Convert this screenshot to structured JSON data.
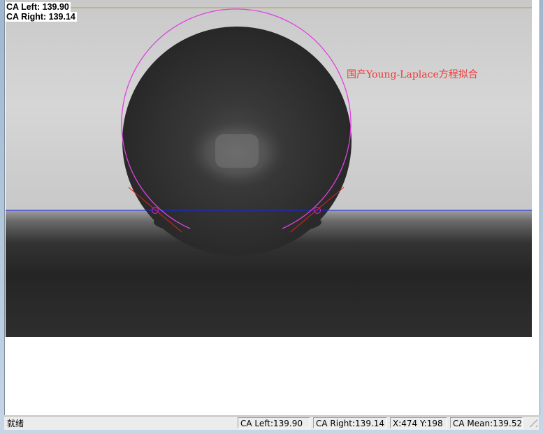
{
  "readouts": {
    "ca_left": "CA Left: 139.90",
    "ca_right": "CA Right: 139.14"
  },
  "fit_label": "国产Young-Laplace方程拟合",
  "status_bar": {
    "status": "就绪",
    "ca_left": "CA Left:139.90",
    "ca_right": "CA Right:139.14",
    "xy": "X:474 Y:198",
    "ca_mean": "CA Mean:139.52"
  },
  "colors": {
    "fit_curve": "#e040e0",
    "tangent": "#e02020",
    "baseline": "#1a2bd0",
    "marker_line": "#b8a040"
  },
  "icons": {
    "size_grip": "size-grip-icon"
  }
}
